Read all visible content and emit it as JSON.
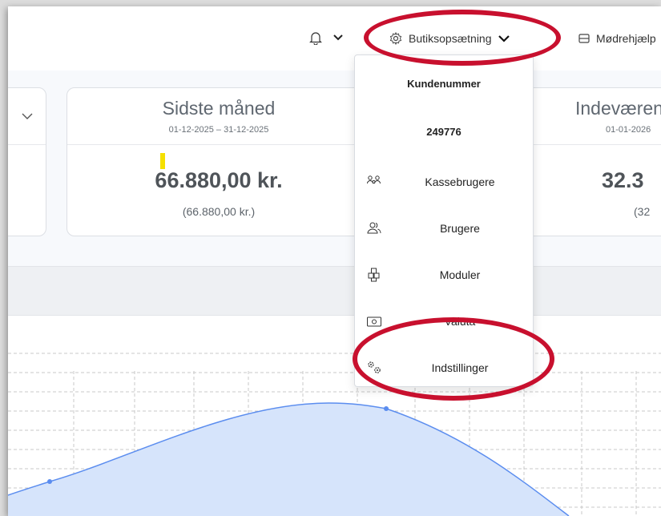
{
  "header": {
    "settings_label": "Butiksopsætning",
    "mode_label": "Mødrehjælp"
  },
  "cards": [
    {
      "title": "Sidste måned",
      "dates": "01-12-2025 – 31-12-2025",
      "value": "66.880,00 kr.",
      "sub": "(66.880,00 kr.)"
    },
    {
      "title": "Indeværende",
      "dates": "01-01-2026",
      "value": "32.3",
      "sub": "(32"
    }
  ],
  "dropdown": {
    "customer_number_label": "Kundenummer",
    "customer_number": "249776",
    "items": [
      {
        "label": "Kassebrugere",
        "icon": "cashier-users-icon"
      },
      {
        "label": "Brugere",
        "icon": "users-icon"
      },
      {
        "label": "Moduler",
        "icon": "modules-icon"
      },
      {
        "label": "Valuta",
        "icon": "currency-icon"
      },
      {
        "label": "Indstillinger",
        "icon": "settings-gears-icon"
      }
    ]
  },
  "colors": {
    "highlight": "#c8102e",
    "chart_fill": "#d6e4fb",
    "chart_line": "#5b8def"
  }
}
